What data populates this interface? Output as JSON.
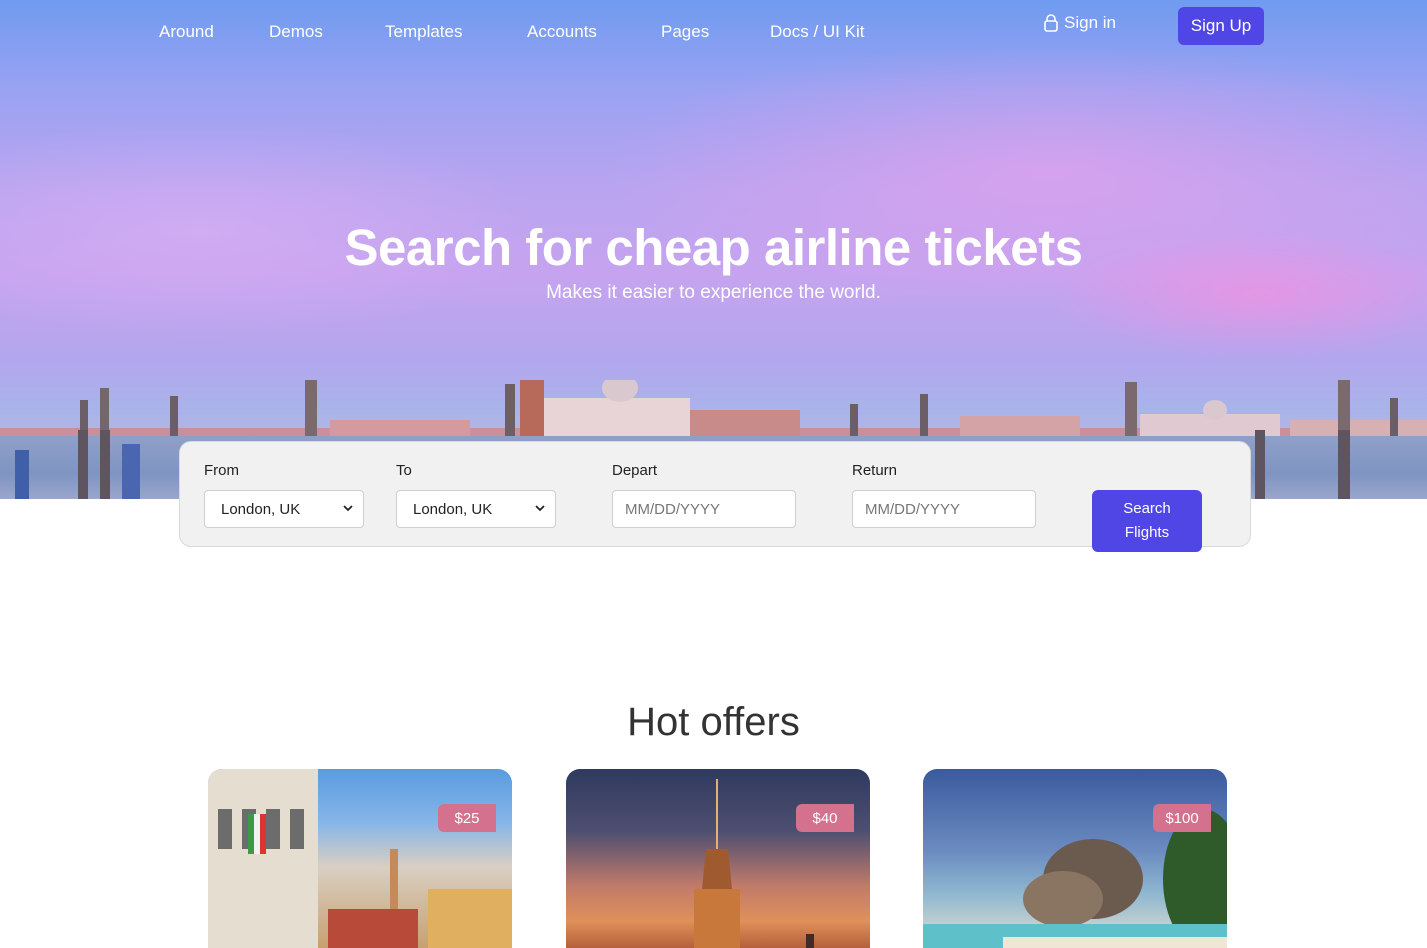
{
  "nav": {
    "links": [
      "Around",
      "Demos",
      "Templates",
      "Accounts",
      "Pages",
      "Docs / UI Kit"
    ],
    "signin": "Sign in",
    "signup": "Sign Up"
  },
  "hero": {
    "title": "Search for cheap airline tickets",
    "subtitle": "Makes it easier to experience the world."
  },
  "search": {
    "from_label": "From",
    "from_value": "London, UK",
    "to_label": "To",
    "to_value": "London, UK",
    "depart_label": "Depart",
    "depart_placeholder": "MM/DD/YYYY",
    "return_label": "Return",
    "return_placeholder": "MM/DD/YYYY",
    "button": "Search Flights"
  },
  "offers": {
    "title": "Hot offers",
    "cards": [
      {
        "price": "$25"
      },
      {
        "price": "$40"
      },
      {
        "price": "$100"
      }
    ]
  },
  "colors": {
    "accent": "#4f46e5",
    "price_badge": "#d4718f"
  }
}
